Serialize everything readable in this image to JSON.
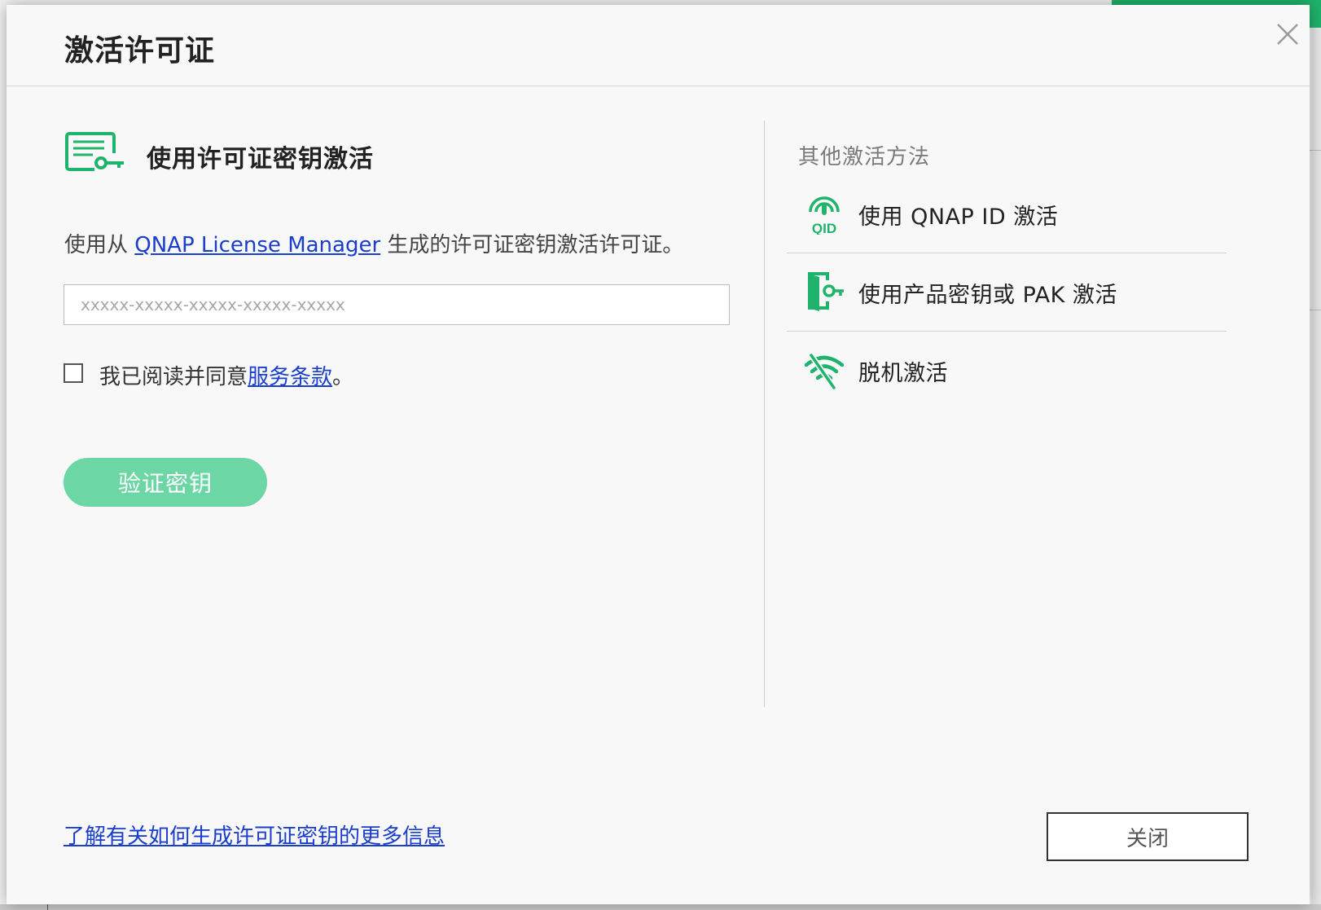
{
  "dialog": {
    "title": "激活许可证",
    "close_icon": "close-icon"
  },
  "left": {
    "icon": "license-certificate-key-icon",
    "section_title": "使用许可证密钥激活",
    "desc_prefix": "使用从 ",
    "desc_link": "QNAP License Manager",
    "desc_suffix": " 生成的许可证密钥激活许可证。",
    "input": {
      "placeholder": "xxxxx-xxxxx-xxxxx-xxxxx-xxxxx",
      "value": ""
    },
    "agree": {
      "checked": false,
      "prefix": "我已阅读并同意",
      "link": "服务条款",
      "suffix": "。"
    },
    "verify_button": "验证密钥"
  },
  "right": {
    "title": "其他激活方法",
    "options": [
      {
        "icon": "qnap-id-icon",
        "label": "使用 QNAP ID 激活"
      },
      {
        "icon": "product-key-door-icon",
        "label": "使用产品密钥或 PAK 激活"
      },
      {
        "icon": "offline-wifi-icon",
        "label": "脱机激活"
      }
    ]
  },
  "footer": {
    "learn_more": "了解有关如何生成许可证密钥的更多信息",
    "close_button": "关闭"
  },
  "colors": {
    "accent_green": "#1fb36b",
    "button_green_disabled": "#6dd6a5",
    "link_blue": "#1a3ecc"
  }
}
